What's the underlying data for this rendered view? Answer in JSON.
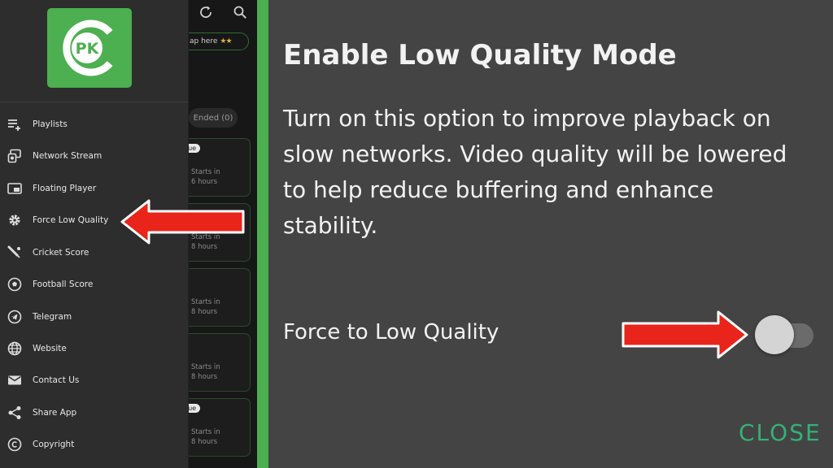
{
  "drawer": {
    "logo_text": "PK",
    "items": [
      {
        "label": "Playlists",
        "icon": "playlist-add-icon"
      },
      {
        "label": "Network Stream",
        "icon": "network-stream-icon"
      },
      {
        "label": "Floating Player",
        "icon": "picture-in-picture-icon"
      },
      {
        "label": "Force Low Quality",
        "icon": "gear-icon"
      },
      {
        "label": "Cricket Score",
        "icon": "cricket-bat-icon"
      },
      {
        "label": "Football Score",
        "icon": "football-icon"
      },
      {
        "label": "Telegram",
        "icon": "telegram-icon"
      },
      {
        "label": "Website",
        "icon": "globe-icon"
      },
      {
        "label": "Contact Us",
        "icon": "mail-icon"
      },
      {
        "label": "Share App",
        "icon": "share-icon"
      },
      {
        "label": "Copyright",
        "icon": "copyright-icon"
      }
    ]
  },
  "background": {
    "tap_text": "ap here",
    "stars": "★★",
    "ended_tab": "Ended (0)",
    "cards": [
      {
        "tag": "gue",
        "starts": "Starts in",
        "time": "6 hours"
      },
      {
        "tag": "",
        "starts": "Starts in",
        "time": "8 hours"
      },
      {
        "tag": "",
        "starts": "Starts in",
        "time": "8 hours"
      },
      {
        "tag": "",
        "starts": "Starts in",
        "time": "8 hours"
      },
      {
        "tag": "gue",
        "starts": "Starts in",
        "time": "8 hours"
      }
    ]
  },
  "dialog": {
    "title": "Enable Low Quality Mode",
    "body": "Turn on this option to improve playback on slow networks. Video quality will be lowered to help reduce buffering and enhance stability.",
    "option_label": "Force to Low Quality",
    "toggle_on": false,
    "close_label": "CLOSE"
  },
  "colors": {
    "accent_green": "#4caf50",
    "close_text": "#32b277",
    "annotation_red": "#e8241b",
    "panel_bg": "#444444",
    "drawer_bg": "#2d2d2d"
  }
}
